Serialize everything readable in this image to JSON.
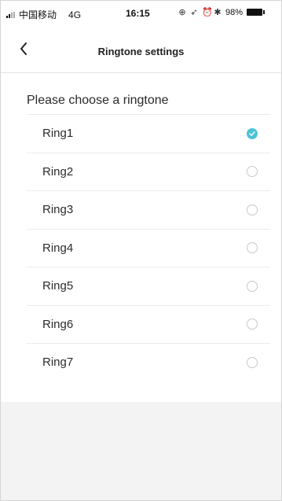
{
  "status_bar": {
    "carrier": "中国移动",
    "network": "4G",
    "time": "16:15",
    "battery": "98%",
    "icons": [
      "signal-icon",
      "lock-rotation-icon",
      "location-icon",
      "alarm-icon",
      "bluetooth-icon",
      "battery-icon"
    ]
  },
  "nav": {
    "back_icon": "chevron-left-icon",
    "title": "Ringtone settings"
  },
  "content": {
    "section_title": "Please choose a ringtone",
    "selected_index": 0,
    "accent_color": "#4cc3d4",
    "items": [
      {
        "label": "Ring1",
        "selected": true
      },
      {
        "label": "Ring2",
        "selected": false
      },
      {
        "label": "Ring3",
        "selected": false
      },
      {
        "label": "Ring4",
        "selected": false
      },
      {
        "label": "Ring5",
        "selected": false
      },
      {
        "label": "Ring6",
        "selected": false
      },
      {
        "label": "Ring7",
        "selected": false
      }
    ]
  }
}
